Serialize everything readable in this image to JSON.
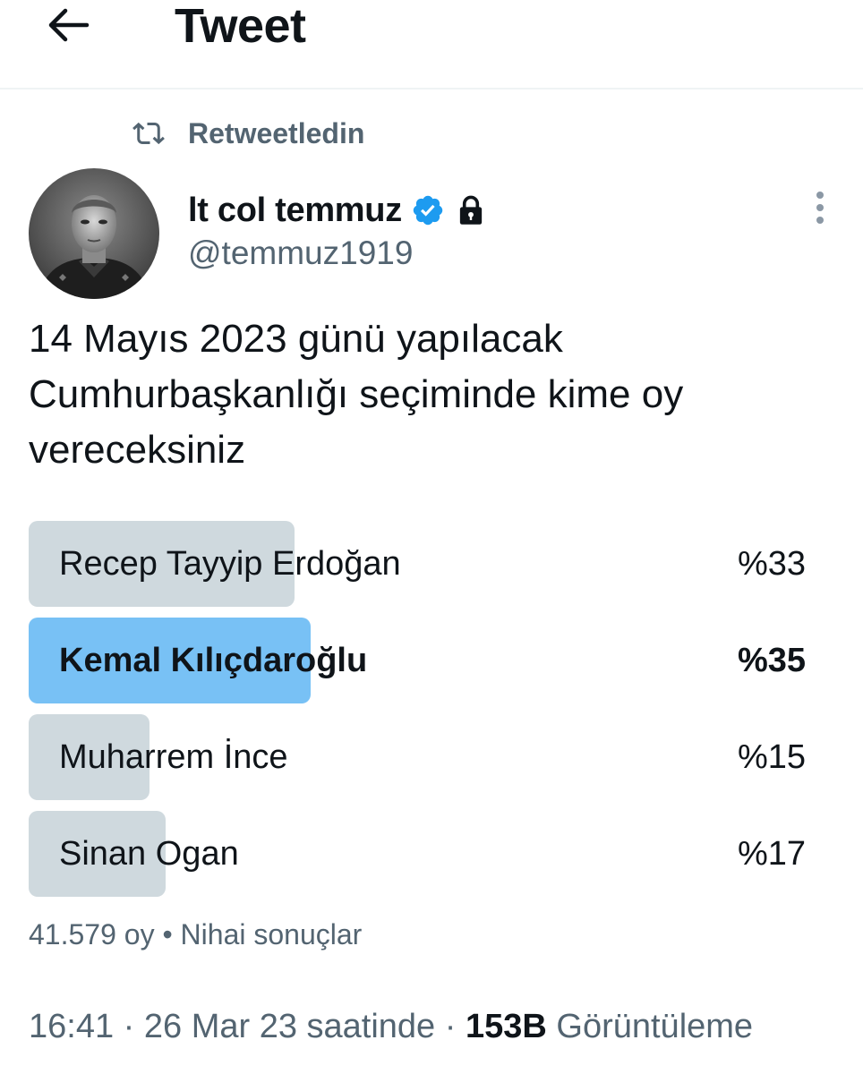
{
  "header": {
    "title": "Tweet",
    "back_icon": "arrow-left-icon"
  },
  "retweet_context": {
    "icon": "retweet-icon",
    "label": "Retweetledin"
  },
  "tweet": {
    "author": {
      "display_name": "lt col temmuz",
      "username": "@temmuz1919",
      "verified": true,
      "protected": true
    },
    "text": "14 Mayıs 2023 günü yapılacak Cumhurbaşkanlığı seçiminde kime oy vereceksiniz",
    "poll": {
      "options": [
        {
          "label": "Recep Tayyip Erdoğan",
          "percent_label": "%33",
          "percent": 33,
          "winner": false
        },
        {
          "label": "Kemal Kılıçdaroğlu",
          "percent_label": "%35",
          "percent": 35,
          "winner": true
        },
        {
          "label": "Muharrem İnce",
          "percent_label": "%15",
          "percent": 15,
          "winner": false
        },
        {
          "label": "Sinan Ogan",
          "percent_label": "%17",
          "percent": 17,
          "winner": false
        }
      ],
      "votes": "41.579 oy",
      "separator": "•",
      "status": "Nihai sonuçlar"
    },
    "time": "16:41",
    "date": "26 Mar 23 saatinde",
    "separator": "·",
    "views_count": "153B",
    "views_label": "Görüntüleme"
  },
  "colors": {
    "text_primary": "#0f1419",
    "text_secondary": "#536471",
    "poll_bar": "#cfd9de",
    "poll_bar_winner": "#78c1f5",
    "verified_blue": "#1d9bf0"
  }
}
